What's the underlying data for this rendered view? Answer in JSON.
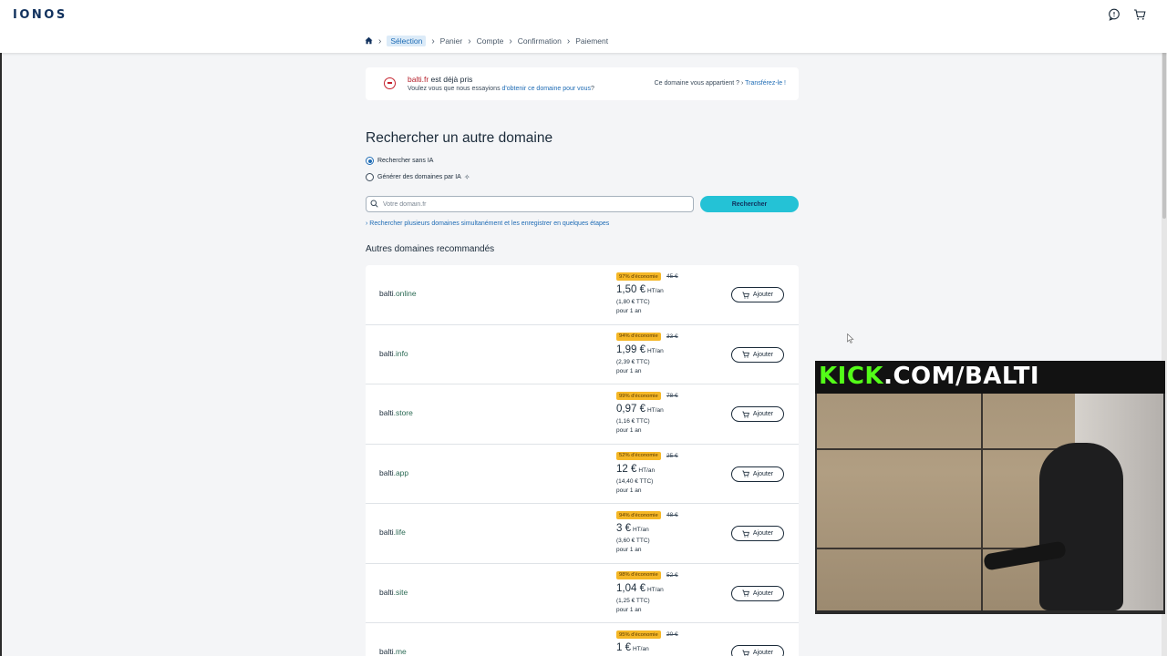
{
  "header": {
    "logo": "IONOS",
    "icons": [
      "chat-icon",
      "cart-icon"
    ]
  },
  "breadcrumb": {
    "home_icon": "home-icon",
    "steps": [
      "Sélection",
      "Panier",
      "Compte",
      "Confirmation",
      "Paiement"
    ],
    "active_index": 0
  },
  "alert": {
    "domain": "balti.fr",
    "title_suffix": " est déjà pris",
    "question": "Voulez vous que nous essayions ",
    "question_link": "d'obtenir ce domaine pour vous",
    "question_end": "?",
    "owner_text": "Ce domaine vous appartient ? ",
    "owner_link": "Transférez-le !"
  },
  "search": {
    "heading": "Rechercher un autre domaine",
    "option_no_ai": "Rechercher sans IA",
    "option_ai": "Générer des domaines par IA",
    "placeholder": "Votre domain.fr",
    "value": "",
    "button": "Rechercher",
    "multi_link": "› Rechercher plusieurs domaines simultanément et les enregistrer en quelques étapes"
  },
  "recommendations": {
    "heading": "Autres domaines recommandés",
    "add_label": "Ajouter",
    "items": [
      {
        "name": "balti",
        "tld": ".online",
        "badge": "97% d'économie",
        "old": "45 €",
        "price": "1,50 €",
        "unit": "HT/an",
        "ttc": "(1,80 € TTC)",
        "period": "pour 1 an"
      },
      {
        "name": "balti",
        "tld": ".info",
        "badge": "94% d'économie",
        "old": "33 €",
        "price": "1,99 €",
        "unit": "HT/an",
        "ttc": "(2,39 € TTC)",
        "period": "pour 1 an"
      },
      {
        "name": "balti",
        "tld": ".store",
        "badge": "99% d'économie",
        "old": "78 €",
        "price": "0,97 €",
        "unit": "HT/an",
        "ttc": "(1,16 € TTC)",
        "period": "pour 1 an"
      },
      {
        "name": "balti",
        "tld": ".app",
        "badge": "52% d'économie",
        "old": "25 €",
        "price": "12 €",
        "unit": "HT/an",
        "ttc": "(14,40 € TTC)",
        "period": "pour 1 an"
      },
      {
        "name": "balti",
        "tld": ".life",
        "badge": "94% d'économie",
        "old": "48 €",
        "price": "3 €",
        "unit": "HT/an",
        "ttc": "(3,60 € TTC)",
        "period": "pour 1 an"
      },
      {
        "name": "balti",
        "tld": ".site",
        "badge": "98% d'économie",
        "old": "52 €",
        "price": "1,04 €",
        "unit": "HT/an",
        "ttc": "(1,25 € TTC)",
        "period": "pour 1 an"
      },
      {
        "name": "balti",
        "tld": ".me",
        "badge": "95% d'économie",
        "old": "20 €",
        "price": "1 €",
        "unit": "HT/an",
        "ttc": "",
        "period": ""
      }
    ]
  },
  "stream_overlay": {
    "brand": "KICK",
    "rest": ".COM/BALTI"
  },
  "colors": {
    "brand_navy": "#11315d",
    "accent_cyan": "#24c2d6",
    "link_blue": "#1f6cb5",
    "error_red": "#c4202c",
    "badge_yellow": "#f5b726",
    "kick_green": "#53fc18"
  }
}
